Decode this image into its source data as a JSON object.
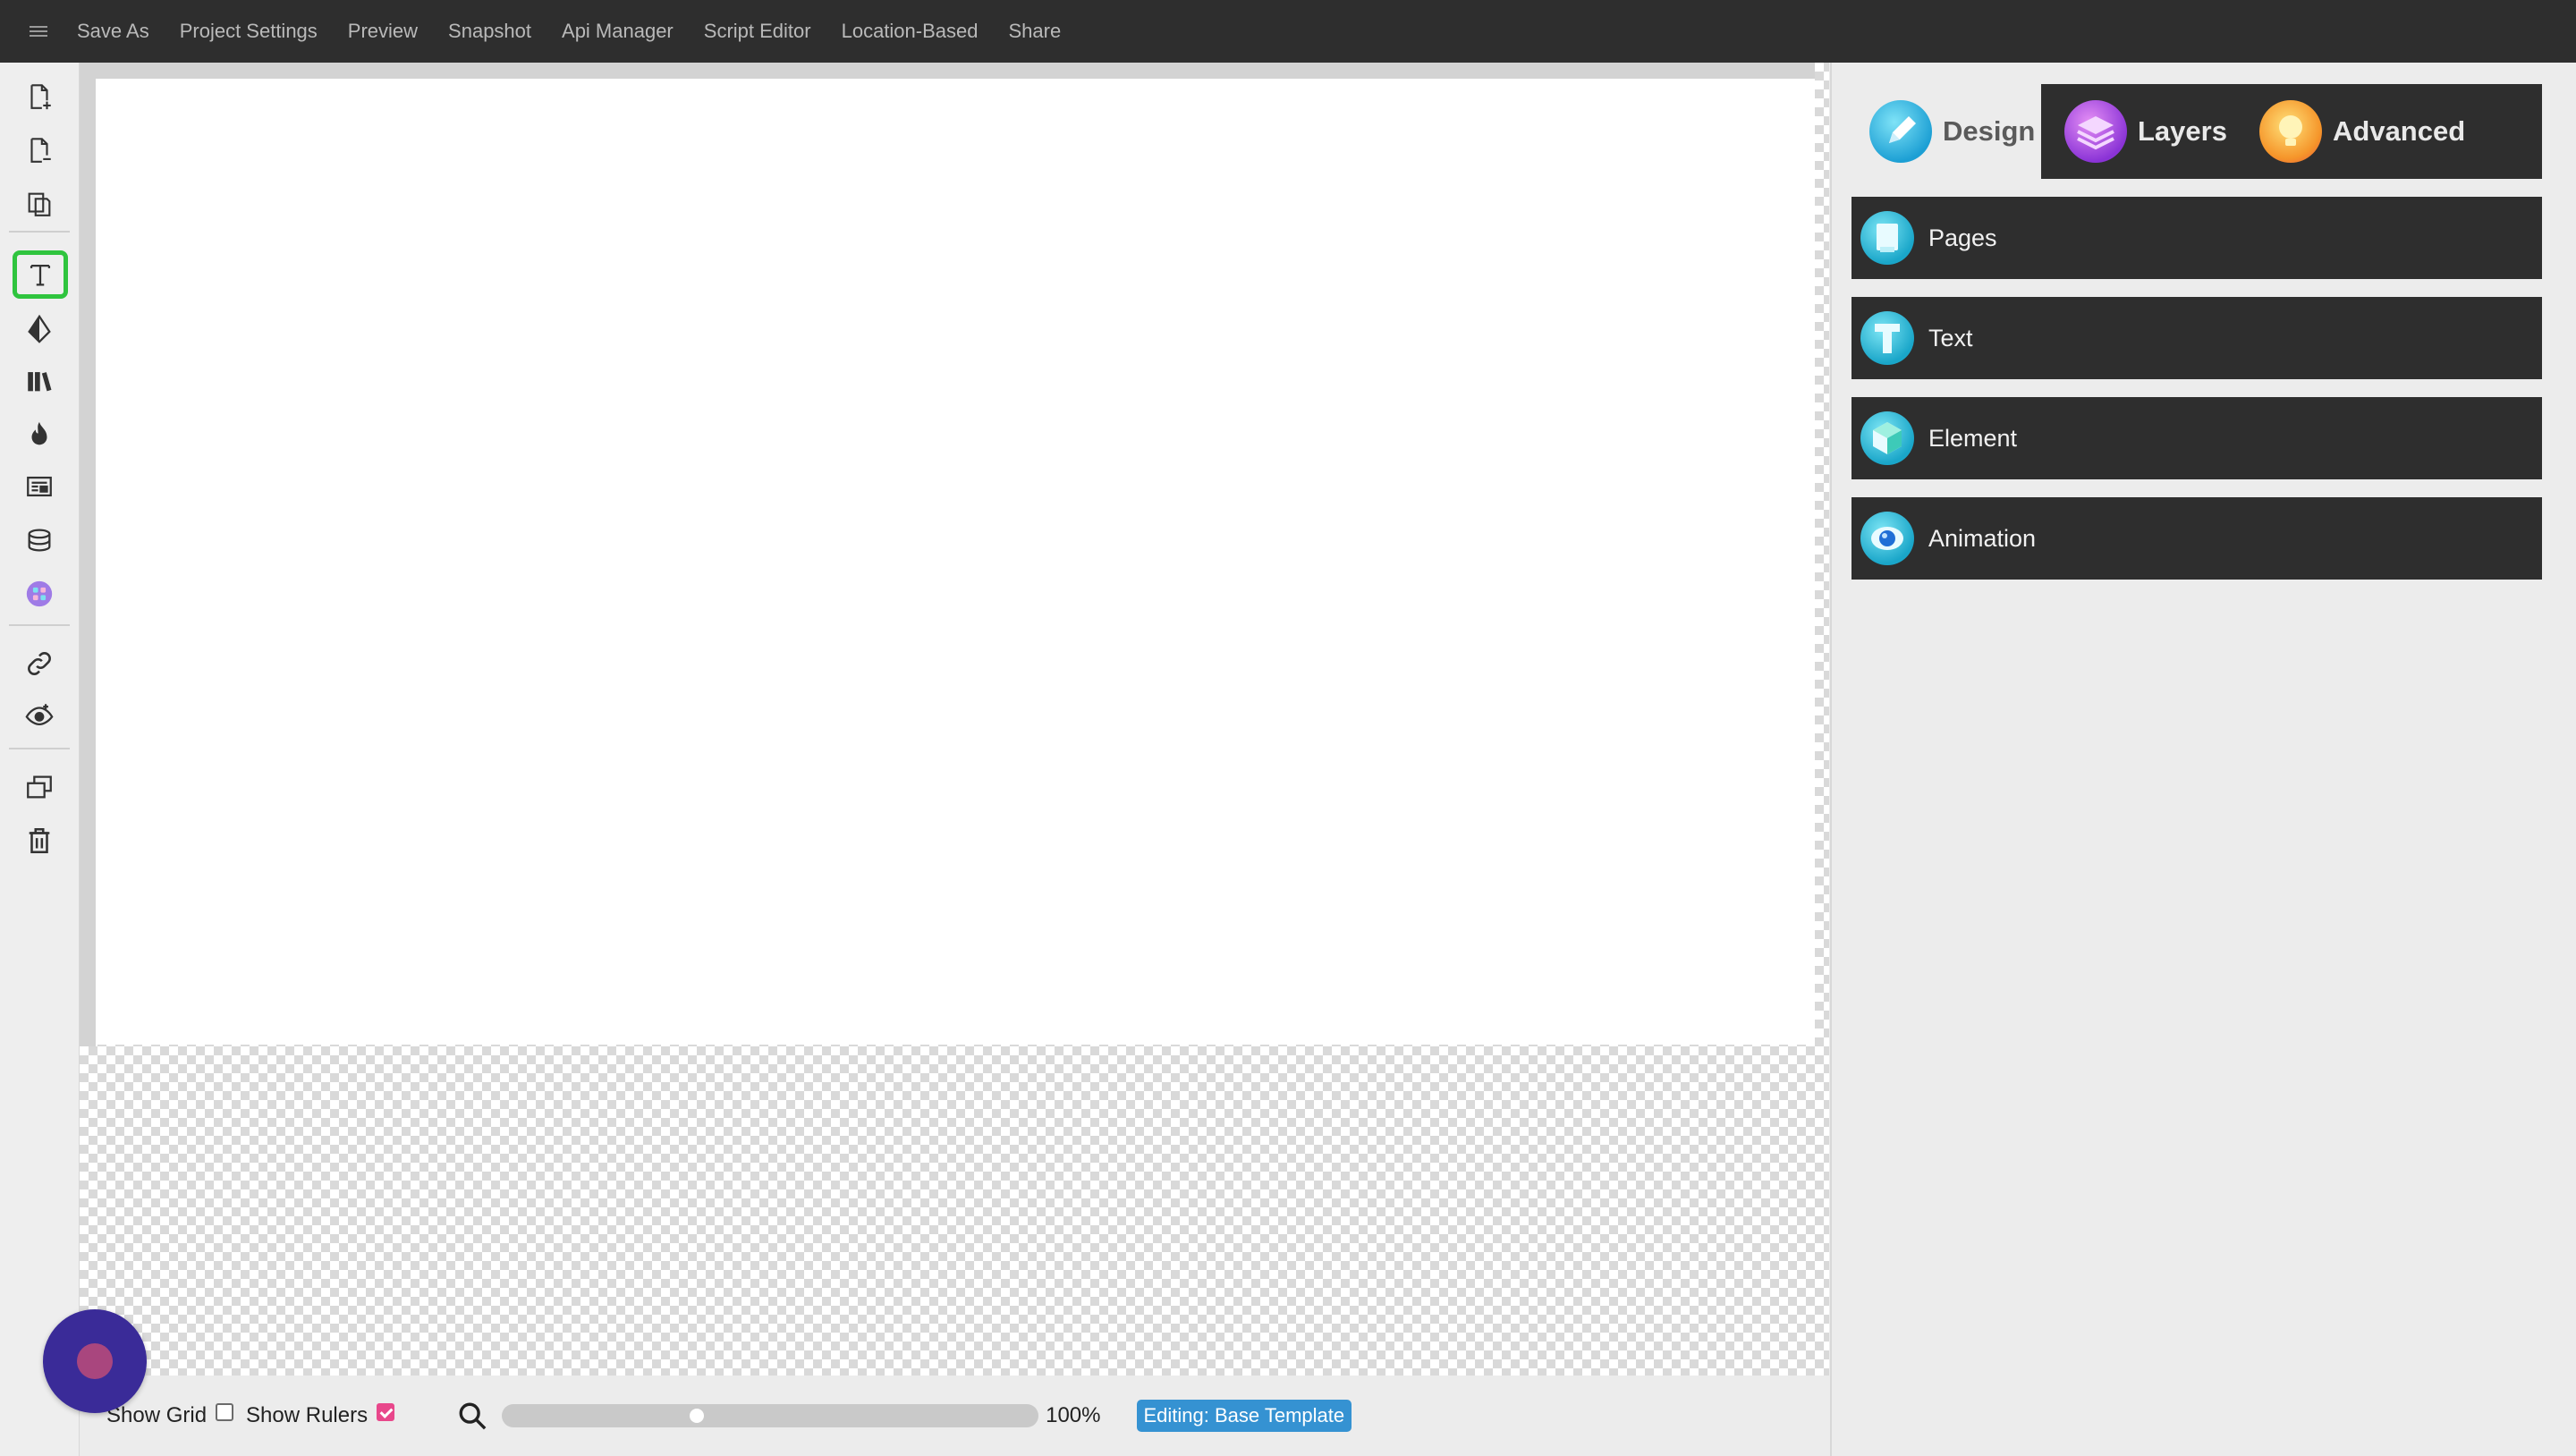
{
  "menu": {
    "items": [
      "Save As",
      "Project Settings",
      "Preview",
      "Snapshot",
      "Api Manager",
      "Script Editor",
      "Location-Based",
      "Share"
    ]
  },
  "toolbar": {
    "tools": [
      {
        "name": "add-page-icon"
      },
      {
        "name": "remove-page-icon"
      },
      {
        "name": "duplicate-page-icon"
      },
      {
        "name": "text-tool-icon",
        "active": true
      },
      {
        "name": "shape-tool-icon"
      },
      {
        "name": "library-icon"
      },
      {
        "name": "fire-icon"
      },
      {
        "name": "form-icon"
      },
      {
        "name": "database-icon"
      },
      {
        "name": "apps-icon"
      },
      {
        "name": "link-icon"
      },
      {
        "name": "preview-eye-icon"
      },
      {
        "name": "copy-icon"
      },
      {
        "name": "delete-icon"
      }
    ]
  },
  "panel": {
    "tabs": [
      {
        "label": "Design",
        "active": true,
        "icon": "pencil-icon",
        "color": "#2fb6e0"
      },
      {
        "label": "Layers",
        "active": false,
        "icon": "layers-icon",
        "color": "#b34bdf"
      },
      {
        "label": "Advanced",
        "active": false,
        "icon": "lightbulb-icon",
        "color": "#f5b12a"
      }
    ],
    "sections": [
      {
        "label": "Pages",
        "icon": "pages-icon"
      },
      {
        "label": "Text",
        "icon": "text-icon"
      },
      {
        "label": "Element",
        "icon": "element-icon"
      },
      {
        "label": "Animation",
        "icon": "animation-icon"
      }
    ]
  },
  "bottom": {
    "show_grid_label": "Show Grid",
    "show_grid_checked": false,
    "show_rulers_label": "Show Rulers",
    "show_rulers_checked": true,
    "zoom_label": "100%",
    "zoom_fraction": 0.36,
    "editing_badge": "Editing: Base Template"
  },
  "colors": {
    "topbar": "#2e2e2e",
    "accent_active_tool": "#2fc43e",
    "badge": "#3592d2",
    "checkbox_on": "#e8478b",
    "fab": "#3a2b98"
  }
}
